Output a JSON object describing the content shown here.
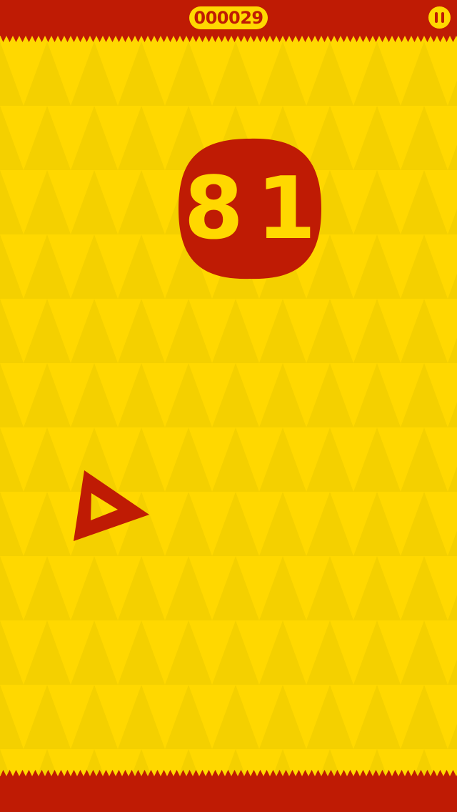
{
  "game": {
    "score": "000029",
    "counter": "81"
  },
  "controls": {
    "pause_icon": "pause-icon"
  },
  "player": {
    "icon": "triangle-ship-icon"
  },
  "colors": {
    "background": "#FFD800",
    "background_shade": "#F4D000",
    "accent": "#BF1B04"
  }
}
